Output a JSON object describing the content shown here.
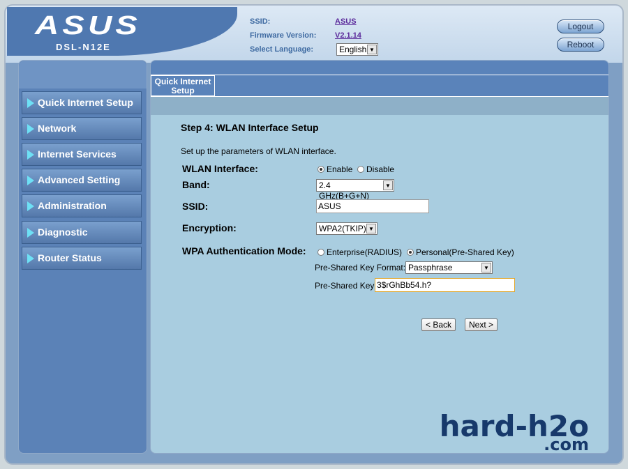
{
  "brand": {
    "logo": "ASUS",
    "model": "DSL-N12E"
  },
  "header": {
    "ssid_label": "SSID:",
    "ssid_value": "ASUS",
    "firmware_label": "Firmware Version:",
    "firmware_value": "V2.1.14",
    "language_label": "Select Language:",
    "language_value": "English",
    "logout_label": "Logout",
    "reboot_label": "Reboot"
  },
  "sidebar": {
    "items": [
      {
        "label": "Quick Internet Setup"
      },
      {
        "label": "Network"
      },
      {
        "label": "Internet Services"
      },
      {
        "label": "Advanced Setting"
      },
      {
        "label": "Administration"
      },
      {
        "label": "Diagnostic"
      },
      {
        "label": "Router Status"
      }
    ]
  },
  "tabs": [
    {
      "label": "Quick Internet Setup"
    }
  ],
  "main": {
    "step_title": "Step 4: WLAN Interface Setup",
    "description": "Set up the parameters of WLAN interface.",
    "wlan_interface_label": "WLAN Interface:",
    "enable_label": "Enable",
    "disable_label": "Disable",
    "band_label": "Band:",
    "band_value": "2.4 GHz(B+G+N)",
    "ssid_label": "SSID:",
    "ssid_value": "ASUS",
    "encryption_label": "Encryption:",
    "encryption_value": "WPA2(TKIP)",
    "wpa_mode_label": "WPA Authentication Mode:",
    "enterprise_label": "Enterprise(RADIUS)",
    "personal_label": "Personal(Pre-Shared Key)",
    "psk_format_label": "Pre-Shared Key Format:",
    "psk_format_value": "Passphrase",
    "psk_label": "Pre-Shared Key:",
    "psk_value": "3$rGhBb54.h?",
    "back_label": "< Back",
    "next_label": "Next >"
  },
  "watermark": {
    "line1": "hard-h2o",
    "line2": ".com"
  },
  "colors": {
    "accent": "#5a83ba",
    "content_bg": "#a9cde0",
    "menu_arrow": "#6ee0f5"
  }
}
